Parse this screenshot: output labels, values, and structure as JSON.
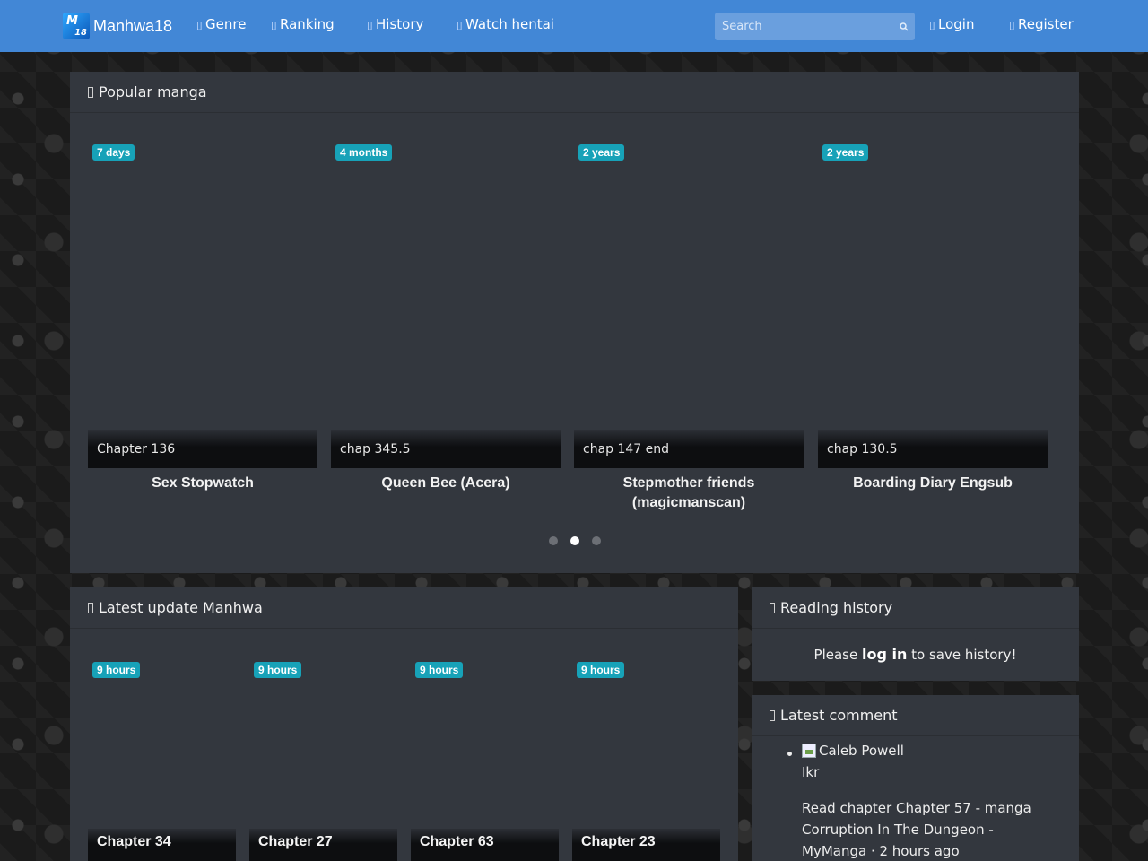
{
  "nav": {
    "brand": "Manhwa18",
    "items": [
      {
        "label": "Genre"
      },
      {
        "label": "Ranking"
      },
      {
        "label": "History"
      },
      {
        "label": "Watch hentai"
      }
    ],
    "search_placeholder": "Search",
    "login": "Login",
    "register": "Register",
    "bar_color": "#4287d6"
  },
  "popular": {
    "heading": "Popular manga",
    "cards": [
      {
        "badge": "7 days",
        "chapter": "Chapter 136",
        "title": "Sex Stopwatch"
      },
      {
        "badge": "4 months",
        "chapter": "chap 345.5",
        "title": "Queen Bee (Acera)"
      },
      {
        "badge": "2 years",
        "chapter": "chap 147 end",
        "title": "Stepmother friends (magicmanscan)"
      },
      {
        "badge": "2 years",
        "chapter": "chap 130.5",
        "title": "Boarding Diary Engsub"
      }
    ],
    "pagination": {
      "count": 3,
      "active": 2
    }
  },
  "latest": {
    "heading": "Latest update Manhwa",
    "cards": [
      {
        "badge": "9 hours",
        "chapter": "Chapter 34"
      },
      {
        "badge": "9 hours",
        "chapter": "Chapter 27"
      },
      {
        "badge": "9 hours",
        "chapter": "Chapter 63"
      },
      {
        "badge": "9 hours",
        "chapter": "Chapter 23"
      }
    ]
  },
  "history": {
    "heading": "Reading history",
    "msg_before": "Please",
    "msg_link": "log in",
    "msg_after": "to save history!"
  },
  "comments": {
    "heading": "Latest comment",
    "items": [
      {
        "user": "Caleb Powell",
        "text": "Ikr",
        "meta": "Read chapter Chapter 57 - manga Corruption In The Dungeon - MyManga · 2 hours ago"
      }
    ]
  },
  "colors": {
    "badge": "#17a2b8",
    "panel": "#33373e",
    "accent": "#4287d6"
  }
}
